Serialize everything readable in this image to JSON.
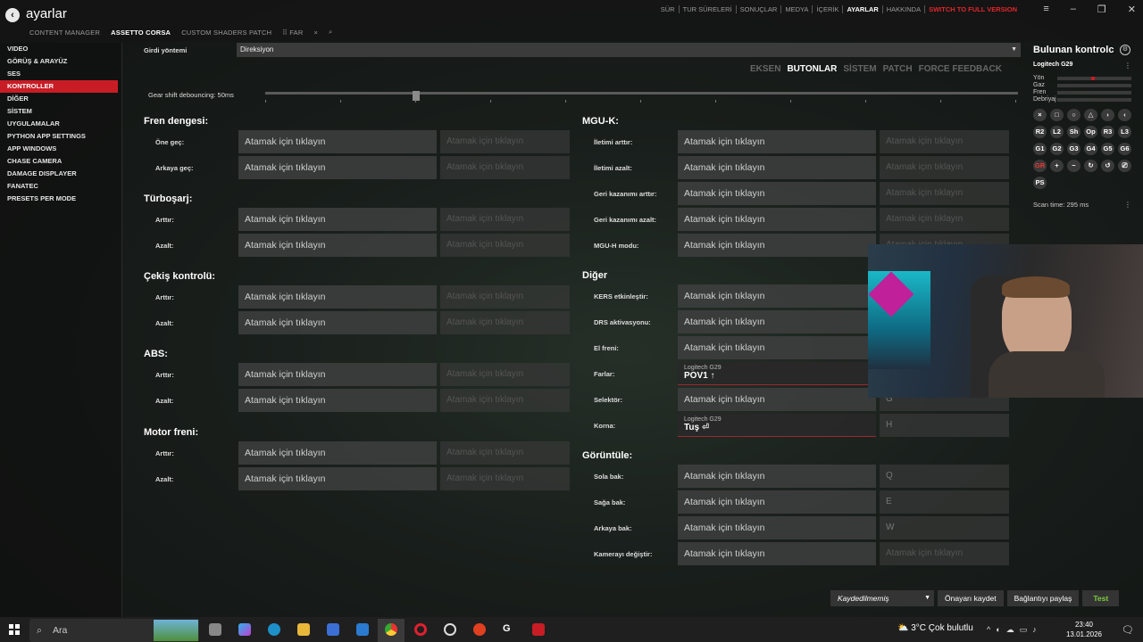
{
  "app": {
    "title": "ayarlar",
    "back_icon": "back-arrow-icon"
  },
  "tabs": [
    "CONTENT MANAGER",
    "ASSETTO CORSA",
    "CUSTOM SHADERS PATCH",
    "⠿ FAR",
    "×"
  ],
  "topnav": {
    "items": [
      "SÜR",
      "TUR SÜRELERİ",
      "SONUÇLAR",
      "MEDYA",
      "İÇERİK",
      "AYARLAR",
      "HAKKINDA"
    ],
    "switch": "SWITCH TO FULL VERSION"
  },
  "sidebar": [
    "VIDEO",
    "GÖRÜŞ & ARAYÜZ",
    "SES",
    "KONTROLLER",
    "DİĞER",
    "SİSTEM",
    "UYGULAMALAR",
    "PYTHON APP SETTINGS",
    "APP WINDOWS",
    "CHASE CAMERA",
    "DAMAGE DISPLAYER",
    "FANATEC",
    "PRESETS PER MODE"
  ],
  "input": {
    "label": "Girdi yöntemi",
    "value": "Direksiyon"
  },
  "subtabs": [
    "EKSEN",
    "BUTONLAR",
    "SİSTEM",
    "PATCH",
    "FORCE FEEDBACK"
  ],
  "gear_shift": {
    "label": "Gear shift debouncing: 50ms"
  },
  "placeholder": "Atamak için tıklayın",
  "left": [
    {
      "title": "Fren dengesi:",
      "rows": [
        "Öne geç:",
        "Arkaya geç:"
      ]
    },
    {
      "title": "Türboşarj:",
      "rows": [
        "Arttır:",
        "Azalt:"
      ]
    },
    {
      "title": "Çekiş kontrolü:",
      "rows": [
        "Arttır:",
        "Azalt:"
      ]
    },
    {
      "title": "ABS:",
      "rows": [
        "Arttır:",
        "Azalt:"
      ]
    },
    {
      "title": "Motor freni:",
      "rows": [
        "Arttır:",
        "Azalt:"
      ]
    }
  ],
  "right": [
    {
      "title": "MGU-K:",
      "rows": [
        {
          "l": "İletimi arttır:"
        },
        {
          "l": "İletimi azalt:"
        },
        {
          "l": "Geri kazanımı arttır:"
        },
        {
          "l": "Geri kazanımı azalt:"
        },
        {
          "l": "MGU-H modu:"
        }
      ]
    },
    {
      "title": "Diğer",
      "rows": [
        {
          "l": "KERS etkinleştir:"
        },
        {
          "l": "DRS aktivasyonu:"
        },
        {
          "l": "El freni:"
        },
        {
          "l": "Farlar:",
          "dev": "Logitech G29",
          "bind": "POV1 ↑"
        },
        {
          "l": "Selektör:",
          "k": "G"
        },
        {
          "l": "Korna:",
          "dev": "Logitech G29",
          "bind": "Tuş ⏎",
          "k": "H"
        }
      ]
    },
    {
      "title": "Görüntüle:",
      "rows": [
        {
          "l": "Sola bak:",
          "k": "Q"
        },
        {
          "l": "Sağa bak:",
          "k": "E"
        },
        {
          "l": "Arkaya bak:",
          "k": "W"
        },
        {
          "l": "Kamerayı değiştir:"
        }
      ]
    }
  ],
  "panel": {
    "title": "Bulunan kontrolc",
    "device": "Logitech G29",
    "axes": [
      "Yön",
      "Gaz",
      "Fren",
      "Debriyaj"
    ],
    "buttons": [
      [
        "×",
        "□",
        "○",
        "△",
        "›",
        "‹"
      ],
      [
        "R2",
        "L2",
        "Sh",
        "Op",
        "R3",
        "L3"
      ],
      [
        "G1",
        "G2",
        "G3",
        "G4",
        "G5",
        "G6"
      ],
      [
        "GR",
        "+",
        "−",
        "↻",
        "↺",
        "⎚"
      ],
      [
        "PS"
      ]
    ],
    "scan": "Scan time: 295 ms"
  },
  "bottom": {
    "preset": "Kaydedilmemiş",
    "save": "Önayarı kaydet",
    "share": "Bağlantıyı paylaş",
    "test": "Test"
  },
  "taskbar": {
    "search": "Ara",
    "weather": "3°C  Çok bulutlu",
    "time": "23:40",
    "date": "13.01.2026"
  }
}
